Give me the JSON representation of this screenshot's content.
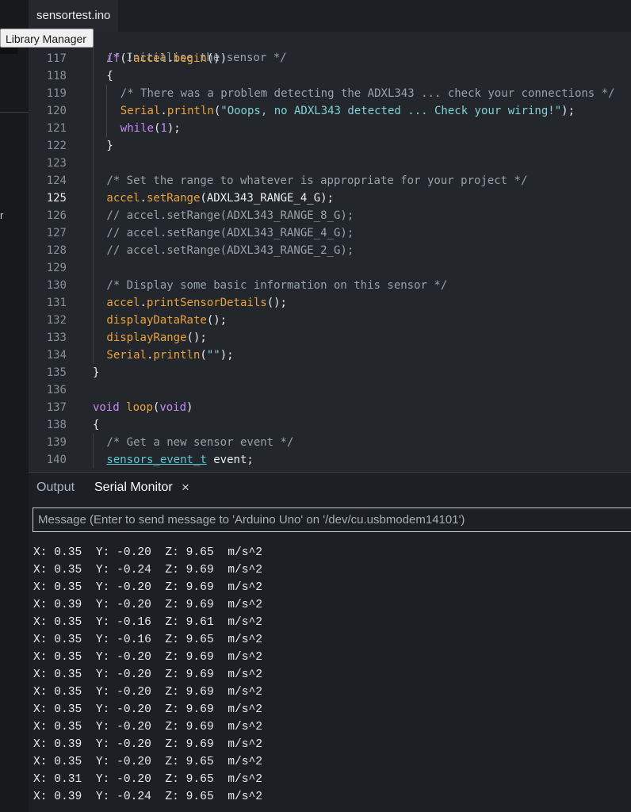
{
  "tab": {
    "filename": "sensortest.ino"
  },
  "tooltip": {
    "text": "Library Manager"
  },
  "sidebar": {
    "partial_label": "r"
  },
  "editor": {
    "active_line": 125,
    "first_line_text": "/* Initialise the sensor */",
    "lines": [
      {
        "num": "117",
        "indent": 1,
        "tokens": [
          [
            "if",
            "kw"
          ],
          [
            "(!",
            "p"
          ],
          [
            "accel",
            "obj"
          ],
          [
            ".",
            "p"
          ],
          [
            "begin",
            "fn"
          ],
          [
            "())",
            "p"
          ]
        ]
      },
      {
        "num": "118",
        "indent": 1,
        "tokens": [
          [
            "{",
            "p"
          ]
        ]
      },
      {
        "num": "119",
        "indent": 2,
        "tokens": [
          [
            "/* There was a problem detecting the ADXL343 ... check your connections */",
            "cm"
          ]
        ]
      },
      {
        "num": "120",
        "indent": 2,
        "tokens": [
          [
            "Serial",
            "obj"
          ],
          [
            ".",
            "p"
          ],
          [
            "println",
            "fn"
          ],
          [
            "(",
            "p"
          ],
          [
            "\"Ooops, no ADXL343 detected ... Check your wiring!\"",
            "str"
          ],
          [
            ");",
            "p"
          ]
        ]
      },
      {
        "num": "121",
        "indent": 2,
        "tokens": [
          [
            "while",
            "kw"
          ],
          [
            "(",
            "p"
          ],
          [
            "1",
            "num"
          ],
          [
            ");",
            "p"
          ]
        ]
      },
      {
        "num": "122",
        "indent": 1,
        "tokens": [
          [
            "}",
            "p"
          ]
        ]
      },
      {
        "num": "123",
        "indent": 1,
        "tokens": []
      },
      {
        "num": "124",
        "indent": 1,
        "tokens": [
          [
            "/* Set the range to whatever is appropriate for your project */",
            "cm"
          ]
        ]
      },
      {
        "num": "125",
        "indent": 1,
        "tokens": [
          [
            "accel",
            "obj"
          ],
          [
            ".",
            "p"
          ],
          [
            "setRange",
            "fn"
          ],
          [
            "(ADXL343_RANGE_4_G);",
            "p"
          ]
        ]
      },
      {
        "num": "126",
        "indent": 1,
        "tokens": [
          [
            "// accel.setRange(ADXL343_RANGE_8_G);",
            "cm2"
          ]
        ]
      },
      {
        "num": "127",
        "indent": 1,
        "tokens": [
          [
            "// accel.setRange(ADXL343_RANGE_4_G);",
            "cm2"
          ]
        ]
      },
      {
        "num": "128",
        "indent": 1,
        "tokens": [
          [
            "// accel.setRange(ADXL343_RANGE_2_G);",
            "cm2"
          ]
        ]
      },
      {
        "num": "129",
        "indent": 1,
        "tokens": []
      },
      {
        "num": "130",
        "indent": 1,
        "tokens": [
          [
            "/* Display some basic information on this sensor */",
            "cm"
          ]
        ]
      },
      {
        "num": "131",
        "indent": 1,
        "tokens": [
          [
            "accel",
            "obj"
          ],
          [
            ".",
            "p"
          ],
          [
            "printSensorDetails",
            "fn"
          ],
          [
            "();",
            "p"
          ]
        ]
      },
      {
        "num": "132",
        "indent": 1,
        "tokens": [
          [
            "displayDataRate",
            "fn"
          ],
          [
            "();",
            "p"
          ]
        ]
      },
      {
        "num": "133",
        "indent": 1,
        "tokens": [
          [
            "displayRange",
            "fn"
          ],
          [
            "();",
            "p"
          ]
        ]
      },
      {
        "num": "134",
        "indent": 1,
        "tokens": [
          [
            "Serial",
            "obj"
          ],
          [
            ".",
            "p"
          ],
          [
            "println",
            "fn"
          ],
          [
            "(",
            "p"
          ],
          [
            "\"\"",
            "str"
          ],
          [
            ");",
            "p"
          ]
        ]
      },
      {
        "num": "135",
        "indent": 0,
        "tokens": [
          [
            "}",
            "p"
          ]
        ]
      },
      {
        "num": "136",
        "indent": 0,
        "tokens": []
      },
      {
        "num": "137",
        "indent": 0,
        "tokens": [
          [
            "void",
            "kw"
          ],
          [
            " ",
            "p"
          ],
          [
            "loop",
            "fn"
          ],
          [
            "(",
            "p"
          ],
          [
            "void",
            "kw"
          ],
          [
            ")",
            "p"
          ]
        ]
      },
      {
        "num": "138",
        "indent": 0,
        "tokens": [
          [
            "{",
            "p"
          ]
        ]
      },
      {
        "num": "139",
        "indent": 1,
        "tokens": [
          [
            "/* Get a new sensor event */",
            "cm"
          ]
        ]
      },
      {
        "num": "140",
        "indent": 1,
        "tokens": [
          [
            "sensors_event_t",
            "type"
          ],
          [
            " event;",
            "p"
          ]
        ]
      }
    ]
  },
  "bottom_panel": {
    "tabs": [
      "Output",
      "Serial Monitor"
    ],
    "active_tab": "Serial Monitor",
    "close_glyph": "×",
    "message_placeholder": "Message (Enter to send message to 'Arduino Uno' on '/dev/cu.usbmodem14101')",
    "serial_lines": [
      "X: 0.35  Y: -0.20  Z: 9.65  m/s^2",
      "X: 0.35  Y: -0.24  Z: 9.69  m/s^2",
      "X: 0.35  Y: -0.20  Z: 9.69  m/s^2",
      "X: 0.39  Y: -0.20  Z: 9.69  m/s^2",
      "X: 0.35  Y: -0.16  Z: 9.61  m/s^2",
      "X: 0.35  Y: -0.16  Z: 9.65  m/s^2",
      "X: 0.35  Y: -0.20  Z: 9.69  m/s^2",
      "X: 0.35  Y: -0.20  Z: 9.69  m/s^2",
      "X: 0.35  Y: -0.20  Z: 9.69  m/s^2",
      "X: 0.35  Y: -0.20  Z: 9.69  m/s^2",
      "X: 0.35  Y: -0.20  Z: 9.69  m/s^2",
      "X: 0.39  Y: -0.20  Z: 9.69  m/s^2",
      "X: 0.35  Y: -0.20  Z: 9.65  m/s^2",
      "X: 0.31  Y: -0.20  Z: 9.65  m/s^2",
      "X: 0.39  Y: -0.24  Z: 9.65  m/s^2"
    ]
  },
  "colors": {
    "kw": "#c58af9",
    "obj": "#e8a33d",
    "fn": "#e8a33d",
    "p": "#e8edf1",
    "cm": "#9aa2aa",
    "cm2": "#9aa2aa",
    "str": "#7fd1d6",
    "num": "#c58af9",
    "type": "#5fc7d3"
  }
}
